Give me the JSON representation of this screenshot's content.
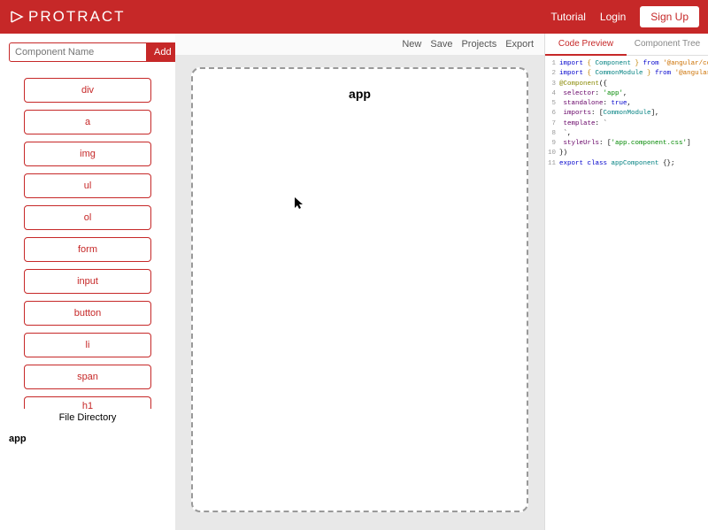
{
  "header": {
    "brand": "PROTRACT",
    "tutorial": "Tutorial",
    "login": "Login",
    "signup": "Sign Up"
  },
  "sidebar": {
    "input_placeholder": "Component Name",
    "add_label": "Add",
    "elements": [
      "div",
      "a",
      "img",
      "ul",
      "ol",
      "form",
      "input",
      "button",
      "li",
      "span",
      "h1"
    ],
    "file_directory_label": "File Directory",
    "file_root": "app"
  },
  "toolbar": {
    "new": "New",
    "save": "Save",
    "projects": "Projects",
    "export": "Export"
  },
  "canvas": {
    "title": "app"
  },
  "right": {
    "tabs": {
      "preview": "Code Preview",
      "tree": "Component Tree"
    },
    "code_lines": [
      {
        "n": "1",
        "tokens": [
          [
            "kw-import",
            "import "
          ],
          [
            "kw-brace",
            "{ "
          ],
          [
            "kw-ident",
            "Component"
          ],
          [
            "kw-brace",
            " }"
          ],
          [
            "kw-from",
            " from "
          ],
          [
            "kw-string",
            "'@angular/core'"
          ],
          [
            "",
            ";"
          ]
        ]
      },
      {
        "n": "2",
        "tokens": [
          [
            "kw-import",
            "import "
          ],
          [
            "kw-brace",
            "{ "
          ],
          [
            "kw-ident",
            "CommonModule"
          ],
          [
            "kw-brace",
            " }"
          ],
          [
            "kw-from",
            " from "
          ],
          [
            "kw-string",
            "'@angular/common'"
          ],
          [
            "",
            ";"
          ]
        ]
      },
      {
        "n": "3",
        "tokens": [
          [
            "kw-deco",
            "@Component"
          ],
          [
            "",
            "({"
          ]
        ]
      },
      {
        "n": "4",
        "tokens": [
          [
            "",
            " "
          ],
          [
            "kw-key",
            "selector"
          ],
          [
            "",
            ": "
          ],
          [
            "kw-val-str",
            "'app'"
          ],
          [
            "",
            ","
          ]
        ]
      },
      {
        "n": "5",
        "tokens": [
          [
            "",
            " "
          ],
          [
            "kw-key",
            "standalone"
          ],
          [
            "",
            ": "
          ],
          [
            "kw-true",
            "true"
          ],
          [
            "",
            ","
          ]
        ]
      },
      {
        "n": "6",
        "tokens": [
          [
            "",
            " "
          ],
          [
            "kw-key",
            "imports"
          ],
          [
            "",
            ": ["
          ],
          [
            "kw-arr",
            "CommonModule"
          ],
          [
            "",
            "],"
          ]
        ]
      },
      {
        "n": "7",
        "tokens": [
          [
            "",
            " "
          ],
          [
            "kw-key",
            "template"
          ],
          [
            "",
            ": `"
          ]
        ]
      },
      {
        "n": "8",
        "tokens": [
          [
            "",
            " `,"
          ]
        ]
      },
      {
        "n": "9",
        "tokens": [
          [
            "",
            " "
          ],
          [
            "kw-key",
            "styleUrls"
          ],
          [
            "",
            ": ["
          ],
          [
            "kw-val-str",
            "'app.component.css'"
          ],
          [
            "",
            "]"
          ]
        ]
      },
      {
        "n": "10",
        "tokens": [
          [
            "",
            "})"
          ]
        ]
      },
      {
        "n": "11",
        "tokens": [
          [
            "kw-export",
            "export "
          ],
          [
            "kw-class",
            "class "
          ],
          [
            "kw-ident",
            "appComponent"
          ],
          [
            "",
            " {};"
          ]
        ]
      }
    ]
  }
}
